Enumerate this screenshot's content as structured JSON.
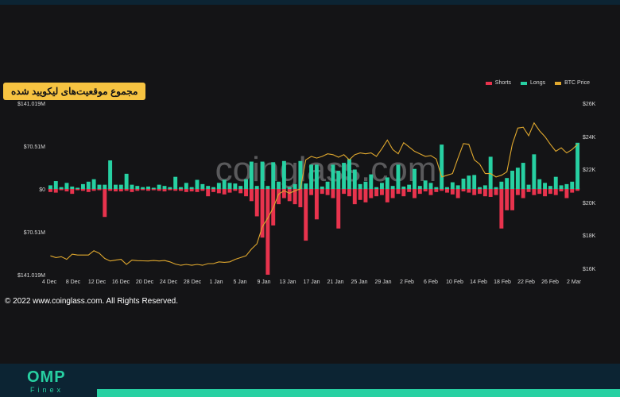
{
  "badge_title": "مجموع موقعیت‌های لیکویید شده",
  "watermark": "coinglass.com",
  "copyright": "© 2022 www.coinglass.com. All Rights Reserved.",
  "logo": {
    "main": "OMP",
    "sub": "Finex"
  },
  "legend": [
    {
      "label": "Shorts",
      "color": "#e8334d"
    },
    {
      "label": "Longs",
      "color": "#27d0a2"
    },
    {
      "label": "BTC Price",
      "color": "#e0a82e"
    }
  ],
  "chart_data": {
    "type": "bar",
    "y_left_ticks": [
      "$141.019M",
      "$70.51M",
      "$0",
      "$70.51M",
      "$141.019M"
    ],
    "y_left_range": [
      -141.019,
      141.019
    ],
    "y_right_ticks": [
      "$26K",
      "$24K",
      "$22K",
      "$20K",
      "$18K",
      "$16K"
    ],
    "y_right_range": [
      16000,
      26000
    ],
    "x_tick_labels": [
      "4 Dec",
      "8 Dec",
      "12 Dec",
      "16 Dec",
      "20 Dec",
      "24 Dec",
      "28 Dec",
      "1 Jan",
      "5 Jan",
      "9 Jan",
      "13 Jan",
      "17 Jan",
      "21 Jan",
      "25 Jan",
      "29 Jan",
      "2 Feb",
      "6 Feb",
      "10 Feb",
      "14 Feb",
      "18 Feb",
      "22 Feb",
      "26 Feb",
      "2 Mar"
    ],
    "series": [
      {
        "name": "Longs",
        "color": "#27d0a2",
        "values": [
          6,
          13,
          3,
          10,
          4,
          2,
          8,
          12,
          16,
          7,
          7,
          47,
          7,
          7,
          25,
          7,
          5,
          3,
          4,
          2,
          7,
          5,
          3,
          20,
          3,
          10,
          3,
          15,
          8,
          5,
          3,
          10,
          15,
          10,
          9,
          5,
          16,
          45,
          5,
          45,
          5,
          44,
          12,
          46,
          3,
          8,
          46,
          9,
          40,
          40,
          4,
          12,
          40,
          30,
          43,
          49,
          32,
          8,
          12,
          24,
          3,
          10,
          19,
          5,
          40,
          4,
          7,
          33,
          5,
          14,
          10,
          3,
          73,
          3,
          11,
          6,
          17,
          22,
          23,
          3,
          6,
          53,
          3,
          12,
          18,
          30,
          35,
          43,
          7,
          57,
          16,
          10,
          5,
          20,
          6,
          8,
          12,
          76
        ]
      },
      {
        "name": "Shorts",
        "color": "#e8334d",
        "values": [
          -5,
          -6,
          -2,
          -4,
          -8,
          -2,
          -3,
          -5,
          -3,
          -2,
          -46,
          -3,
          -4,
          -4,
          -3,
          -5,
          -3,
          -2,
          -3,
          -2,
          -3,
          -4,
          -2,
          -3,
          -3,
          -5,
          -4,
          -5,
          -3,
          -12,
          -5,
          -7,
          -9,
          -6,
          -3,
          -7,
          -12,
          -20,
          -45,
          -80,
          -141,
          -60,
          -25,
          -15,
          -20,
          -25,
          -30,
          -85,
          -10,
          -50,
          -8,
          -10,
          -15,
          -65,
          -8,
          -12,
          -25,
          -18,
          -22,
          -15,
          -12,
          -10,
          -22,
          -15,
          -8,
          -12,
          -5,
          -15,
          -8,
          -4,
          -10,
          -5,
          -3,
          -6,
          -9,
          -15,
          -4,
          -6,
          -10,
          -8,
          -12,
          -13,
          -10,
          -65,
          -35,
          -35,
          -10,
          -15,
          -5,
          -10,
          -8,
          -12,
          -8,
          -10,
          -4,
          -15,
          -6,
          -3
        ]
      },
      {
        "name": "BTC Price",
        "color": "#e0a82e",
        "values": [
          17100,
          17000,
          17050,
          16900,
          17200,
          17150,
          17150,
          17150,
          17400,
          17250,
          16950,
          16800,
          16850,
          16900,
          16600,
          16850,
          16820,
          16810,
          16800,
          16830,
          16800,
          16830,
          16750,
          16620,
          16550,
          16600,
          16550,
          16600,
          16550,
          16650,
          16650,
          16750,
          16720,
          16750,
          16900,
          17000,
          17100,
          17500,
          17800,
          18800,
          19300,
          19900,
          20700,
          20900,
          20750,
          20900,
          21000,
          22700,
          22900,
          22800,
          22900,
          23050,
          23000,
          22850,
          23000,
          22700,
          23000,
          23100,
          23050,
          23100,
          22900,
          23350,
          23850,
          23300,
          23050,
          23700,
          23450,
          23200,
          23050,
          22900,
          22950,
          22750,
          21700,
          21800,
          21900,
          22800,
          23650,
          23600,
          22700,
          22450,
          21900,
          21900,
          21700,
          21800,
          22000,
          23600,
          24550,
          24600,
          24100,
          24850,
          24400,
          24050,
          23600,
          23200,
          23400,
          23100,
          23300,
          23600
        ]
      }
    ]
  }
}
